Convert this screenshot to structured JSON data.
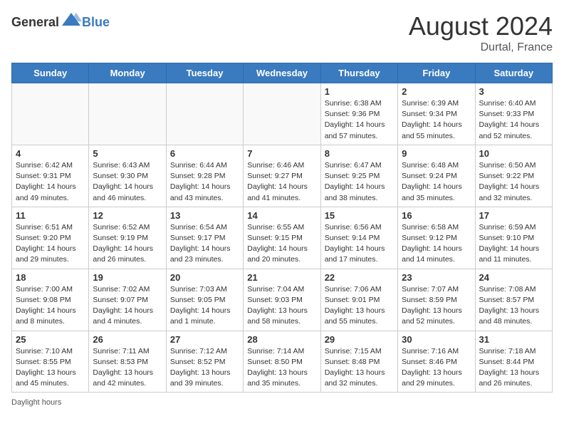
{
  "header": {
    "logo_general": "General",
    "logo_blue": "Blue",
    "month_year": "August 2024",
    "location": "Durtal, France"
  },
  "days_of_week": [
    "Sunday",
    "Monday",
    "Tuesday",
    "Wednesday",
    "Thursday",
    "Friday",
    "Saturday"
  ],
  "weeks": [
    [
      {
        "day": "",
        "info": ""
      },
      {
        "day": "",
        "info": ""
      },
      {
        "day": "",
        "info": ""
      },
      {
        "day": "",
        "info": ""
      },
      {
        "day": "1",
        "info": "Sunrise: 6:38 AM\nSunset: 9:36 PM\nDaylight: 14 hours and 57 minutes."
      },
      {
        "day": "2",
        "info": "Sunrise: 6:39 AM\nSunset: 9:34 PM\nDaylight: 14 hours and 55 minutes."
      },
      {
        "day": "3",
        "info": "Sunrise: 6:40 AM\nSunset: 9:33 PM\nDaylight: 14 hours and 52 minutes."
      }
    ],
    [
      {
        "day": "4",
        "info": "Sunrise: 6:42 AM\nSunset: 9:31 PM\nDaylight: 14 hours and 49 minutes."
      },
      {
        "day": "5",
        "info": "Sunrise: 6:43 AM\nSunset: 9:30 PM\nDaylight: 14 hours and 46 minutes."
      },
      {
        "day": "6",
        "info": "Sunrise: 6:44 AM\nSunset: 9:28 PM\nDaylight: 14 hours and 43 minutes."
      },
      {
        "day": "7",
        "info": "Sunrise: 6:46 AM\nSunset: 9:27 PM\nDaylight: 14 hours and 41 minutes."
      },
      {
        "day": "8",
        "info": "Sunrise: 6:47 AM\nSunset: 9:25 PM\nDaylight: 14 hours and 38 minutes."
      },
      {
        "day": "9",
        "info": "Sunrise: 6:48 AM\nSunset: 9:24 PM\nDaylight: 14 hours and 35 minutes."
      },
      {
        "day": "10",
        "info": "Sunrise: 6:50 AM\nSunset: 9:22 PM\nDaylight: 14 hours and 32 minutes."
      }
    ],
    [
      {
        "day": "11",
        "info": "Sunrise: 6:51 AM\nSunset: 9:20 PM\nDaylight: 14 hours and 29 minutes."
      },
      {
        "day": "12",
        "info": "Sunrise: 6:52 AM\nSunset: 9:19 PM\nDaylight: 14 hours and 26 minutes."
      },
      {
        "day": "13",
        "info": "Sunrise: 6:54 AM\nSunset: 9:17 PM\nDaylight: 14 hours and 23 minutes."
      },
      {
        "day": "14",
        "info": "Sunrise: 6:55 AM\nSunset: 9:15 PM\nDaylight: 14 hours and 20 minutes."
      },
      {
        "day": "15",
        "info": "Sunrise: 6:56 AM\nSunset: 9:14 PM\nDaylight: 14 hours and 17 minutes."
      },
      {
        "day": "16",
        "info": "Sunrise: 6:58 AM\nSunset: 9:12 PM\nDaylight: 14 hours and 14 minutes."
      },
      {
        "day": "17",
        "info": "Sunrise: 6:59 AM\nSunset: 9:10 PM\nDaylight: 14 hours and 11 minutes."
      }
    ],
    [
      {
        "day": "18",
        "info": "Sunrise: 7:00 AM\nSunset: 9:08 PM\nDaylight: 14 hours and 8 minutes."
      },
      {
        "day": "19",
        "info": "Sunrise: 7:02 AM\nSunset: 9:07 PM\nDaylight: 14 hours and 4 minutes."
      },
      {
        "day": "20",
        "info": "Sunrise: 7:03 AM\nSunset: 9:05 PM\nDaylight: 14 hours and 1 minute."
      },
      {
        "day": "21",
        "info": "Sunrise: 7:04 AM\nSunset: 9:03 PM\nDaylight: 13 hours and 58 minutes."
      },
      {
        "day": "22",
        "info": "Sunrise: 7:06 AM\nSunset: 9:01 PM\nDaylight: 13 hours and 55 minutes."
      },
      {
        "day": "23",
        "info": "Sunrise: 7:07 AM\nSunset: 8:59 PM\nDaylight: 13 hours and 52 minutes."
      },
      {
        "day": "24",
        "info": "Sunrise: 7:08 AM\nSunset: 8:57 PM\nDaylight: 13 hours and 48 minutes."
      }
    ],
    [
      {
        "day": "25",
        "info": "Sunrise: 7:10 AM\nSunset: 8:55 PM\nDaylight: 13 hours and 45 minutes."
      },
      {
        "day": "26",
        "info": "Sunrise: 7:11 AM\nSunset: 8:53 PM\nDaylight: 13 hours and 42 minutes."
      },
      {
        "day": "27",
        "info": "Sunrise: 7:12 AM\nSunset: 8:52 PM\nDaylight: 13 hours and 39 minutes."
      },
      {
        "day": "28",
        "info": "Sunrise: 7:14 AM\nSunset: 8:50 PM\nDaylight: 13 hours and 35 minutes."
      },
      {
        "day": "29",
        "info": "Sunrise: 7:15 AM\nSunset: 8:48 PM\nDaylight: 13 hours and 32 minutes."
      },
      {
        "day": "30",
        "info": "Sunrise: 7:16 AM\nSunset: 8:46 PM\nDaylight: 13 hours and 29 minutes."
      },
      {
        "day": "31",
        "info": "Sunrise: 7:18 AM\nSunset: 8:44 PM\nDaylight: 13 hours and 26 minutes."
      }
    ]
  ],
  "footer": {
    "note": "Daylight hours"
  }
}
